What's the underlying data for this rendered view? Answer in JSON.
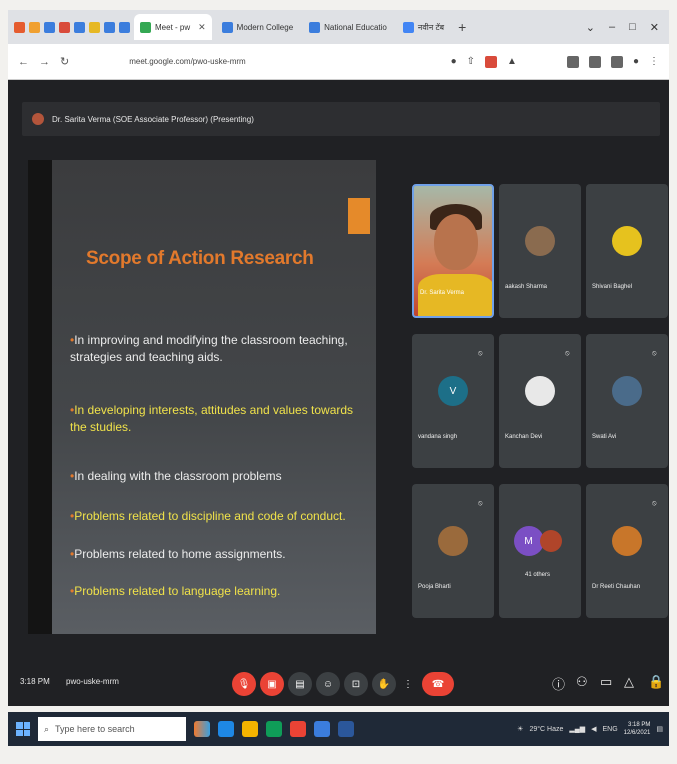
{
  "browser": {
    "tabs": [
      {
        "label": "Meet - pw",
        "active": true
      },
      {
        "label": "Modern College",
        "active": false
      },
      {
        "label": "National Educatio",
        "active": false
      },
      {
        "label": "नवीन टॅब",
        "active": false
      }
    ],
    "new_tab_label": "+",
    "window_controls": [
      "⌄",
      "–",
      "□",
      "✕"
    ],
    "url": "meet.google.com/pwo-uske-mrm"
  },
  "meeting": {
    "presenter_label": "Dr. Sarita Verma (SOE Associate Professor) (Presenting)",
    "time": "3:18 PM",
    "code": "pwo-uske-mrm"
  },
  "slide": {
    "title": "Scope of Action Research",
    "bullets": [
      {
        "text": "In improving and modifying the classroom teaching, strategies and teaching aids.",
        "color": "white"
      },
      {
        "text": "In developing interests, attitudes and values towards the studies.",
        "color": "yellow"
      },
      {
        "text": "In dealing with the classroom problems",
        "color": "white"
      },
      {
        "text": "Problems related to discipline and code of conduct.",
        "color": "yellow"
      },
      {
        "text": "Problems related to home assignments.",
        "color": "white"
      },
      {
        "text": "Problems related to language learning.",
        "color": "yellow"
      }
    ]
  },
  "participants": [
    {
      "name": "Dr. Sarita Verma",
      "self": true
    },
    {
      "name": "aakash Sharma"
    },
    {
      "name": "Shivani Baghel"
    },
    {
      "name": "vandana singh",
      "initial": "V"
    },
    {
      "name": "Kanchan Devi"
    },
    {
      "name": "Swati Avi"
    },
    {
      "name": "Pooja Bharti"
    },
    {
      "name": "41 others",
      "initial": "M"
    },
    {
      "name": "Dr Reeti Chauhan"
    }
  ],
  "taskbar": {
    "search_placeholder": "Type here to search",
    "weather": "29°C Haze",
    "language": "ENG",
    "clock_time": "3:18 PM",
    "clock_date": "12/6/2021"
  },
  "colors": {
    "accent": "#e2792c",
    "bullet_yellow": "#f0e24a",
    "meet_red": "#ea4335"
  }
}
